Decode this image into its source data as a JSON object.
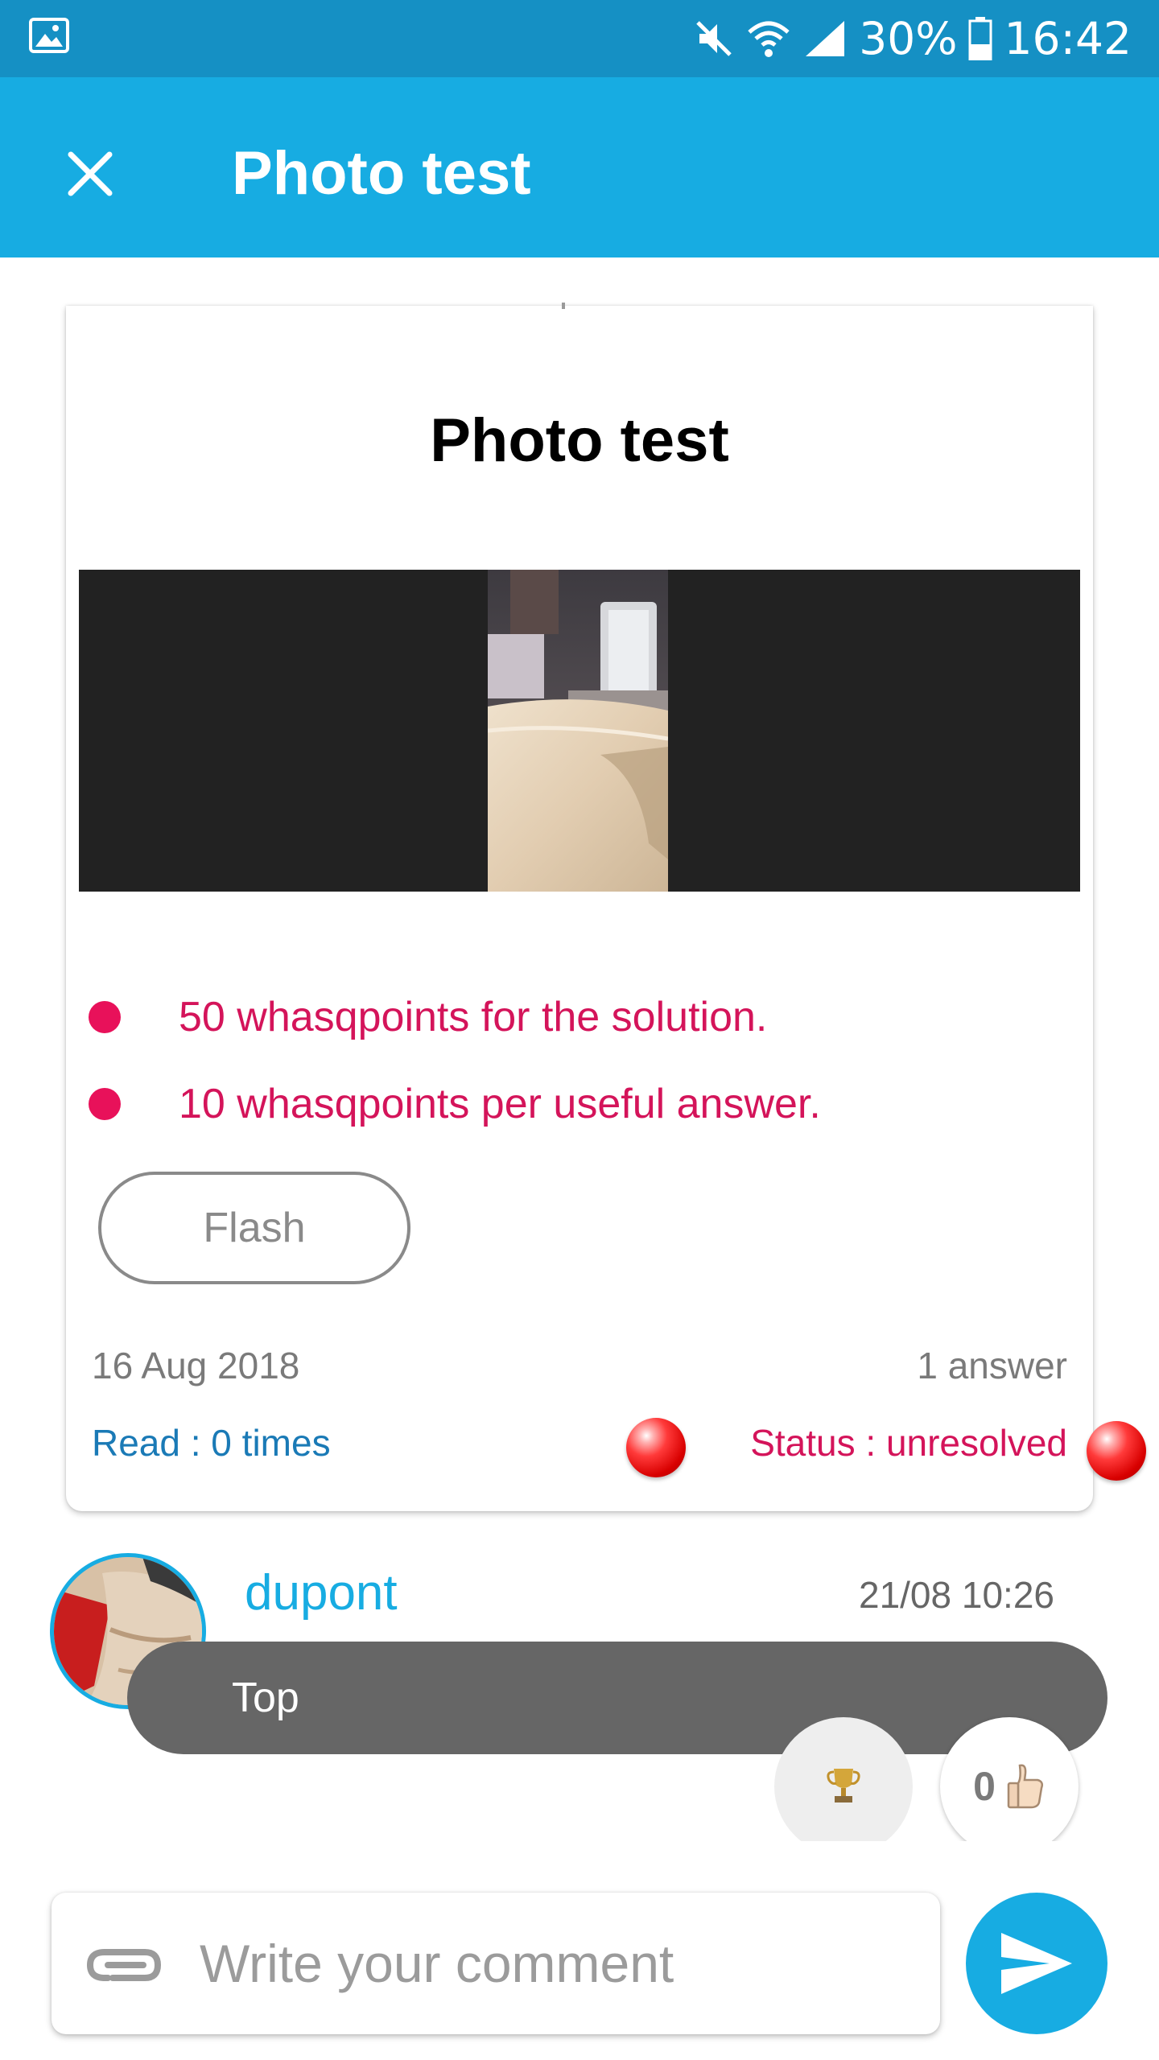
{
  "status_bar": {
    "icons": [
      "gallery-icon",
      "mute-icon",
      "wifi-icon",
      "signal-icon",
      "battery-icon"
    ],
    "battery": "30%",
    "time": "16:42"
  },
  "app_bar": {
    "title": "Photo test",
    "close_icon": "close-icon"
  },
  "question": {
    "title": "Photo test",
    "rewards": [
      "50 whasqpoints for the solution.",
      "10 whasqpoints per useful answer."
    ],
    "flash_label": "Flash",
    "date": "16 Aug 2018",
    "answers_count": "1 answer",
    "read": "Read : 0 times",
    "status": "Status : unresolved"
  },
  "answer": {
    "author": "dupont",
    "time": "21/08 10:26",
    "text": "Top",
    "likes": "0",
    "trophy_icon": "trophy-icon",
    "like_icon": "thumbs-up-icon"
  },
  "composer": {
    "placeholder": "Write your comment",
    "attach_icon": "paperclip-icon",
    "send_icon": "send-icon"
  },
  "colors": {
    "status_bar": "#1590c4",
    "app_bar": "#17ace2",
    "accent": "#17ace2",
    "reward_text": "#d4145a",
    "link_blue": "#1a7ab6",
    "bubble": "#666666"
  }
}
